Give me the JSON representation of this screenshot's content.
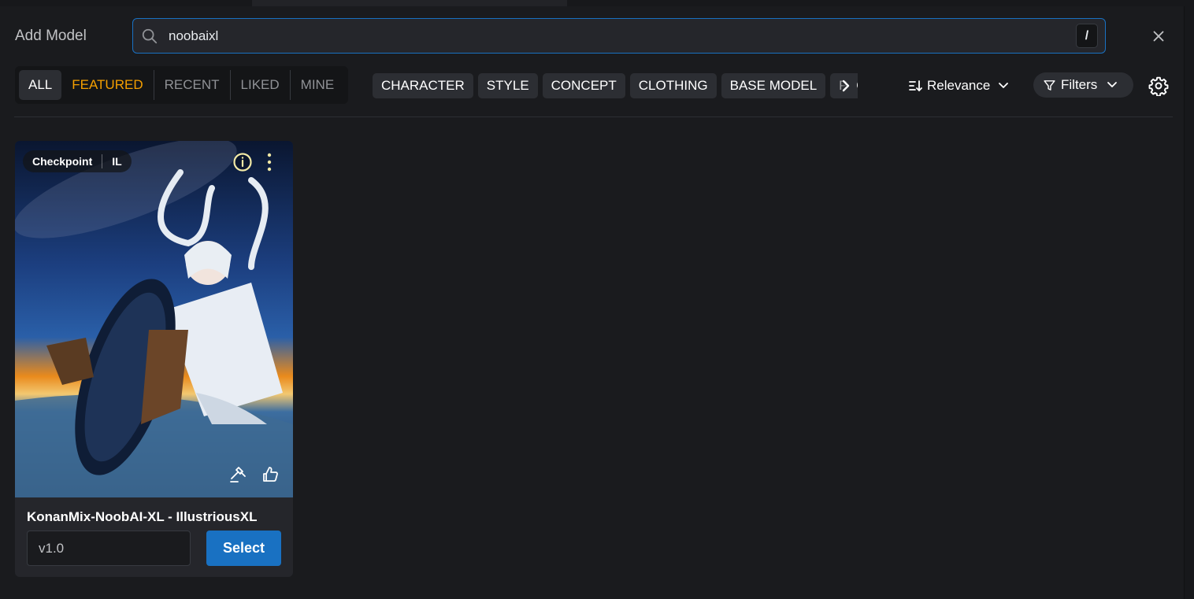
{
  "modal": {
    "title": "Add Model"
  },
  "search": {
    "value": "noobaixl",
    "shortcut": "/",
    "icon": "search-icon"
  },
  "tabs": [
    {
      "label": "ALL",
      "active": true
    },
    {
      "label": "FEATURED",
      "highlight": "#f59f00"
    },
    {
      "label": "RECENT"
    },
    {
      "label": "LIKED"
    },
    {
      "label": "MINE"
    }
  ],
  "categories": [
    "CHARACTER",
    "STYLE",
    "CONCEPT",
    "CLOTHING",
    "BASE MODEL",
    "POSES"
  ],
  "sort": {
    "label": "Relevance"
  },
  "filters": {
    "label": "Filters"
  },
  "colors": {
    "accent": "#1971c2",
    "featured": "#f59f00",
    "background": "#1a1b1e"
  },
  "cards": [
    {
      "type_badge": "Checkpoint",
      "base_badge": "IL",
      "title": "KonanMix-NoobAI-XL - IllustriousXL",
      "version": "v1.0",
      "select_label": "Select"
    }
  ]
}
